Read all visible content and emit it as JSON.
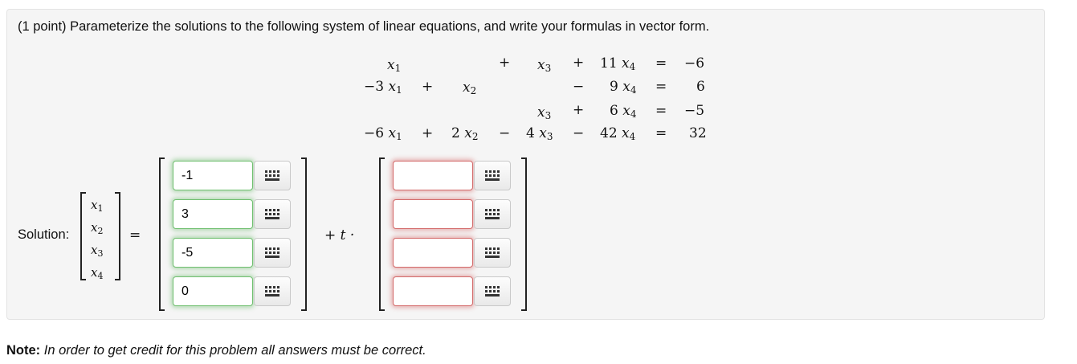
{
  "intro": "(1 point) Parameterize the solutions to the following system of linear equations, and write your formulas in vector form.",
  "equations": {
    "row1": {
      "c1": "",
      "op2": "",
      "c2": "",
      "op3": "+",
      "c3": "",
      "op4": "+",
      "c4": "11",
      "eq": "=",
      "rhs": "−6"
    },
    "row2": {
      "c1": "−3",
      "op2": "+",
      "c2": "",
      "op3": "",
      "c3": "",
      "op4": "−",
      "c4": "9",
      "eq": "=",
      "rhs": "6"
    },
    "row3": {
      "c1": "",
      "op2": "",
      "c2": "",
      "op3": "",
      "c3": "",
      "op4": "+",
      "c4": "6",
      "eq": "=",
      "rhs": "−5"
    },
    "row4": {
      "c1": "−6",
      "op2": "+",
      "c2": "2",
      "op3": "−",
      "c3": "4",
      "op4": "−",
      "c4": "42",
      "eq": "=",
      "rhs": "32"
    },
    "var": "x",
    "sub1": "1",
    "sub2": "2",
    "sub3": "3",
    "sub4": "4"
  },
  "solution": {
    "label": "Solution:",
    "equals": "=",
    "plus_t": "+ t ·",
    "particular": [
      "-1",
      "3",
      "-5",
      "0"
    ],
    "direction": [
      "",
      "",
      "",
      ""
    ]
  },
  "note": {
    "bold": "Note:",
    "text": "In order to get credit for this problem all answers must be correct."
  },
  "icons": {
    "keyboard": "keyboard-icon"
  },
  "colors": {
    "correct": "#6fbf6f",
    "wrong": "#d36a6a"
  }
}
